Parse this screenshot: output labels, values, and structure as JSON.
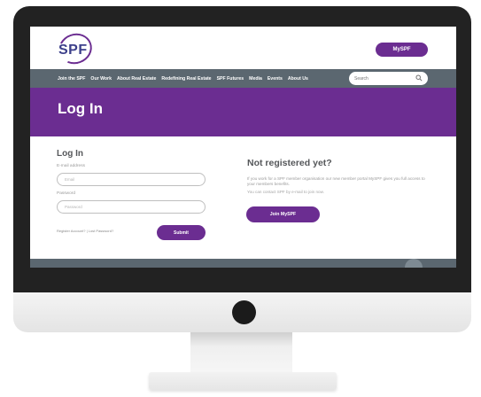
{
  "header": {
    "logo_text": "SPF",
    "myspf_label": "MySPF"
  },
  "nav": {
    "items": [
      "Join the SPF",
      "Our Work",
      "About Real Estate",
      "Redefining Real Estate",
      "SPF Futures",
      "Media",
      "Events",
      "About Us"
    ],
    "search_placeholder": "Search"
  },
  "hero": {
    "title": "Log In"
  },
  "login": {
    "heading": "Log In",
    "email_label": "E-mail address",
    "email_placeholder": "Email",
    "password_label": "Password",
    "password_placeholder": "Password",
    "links_text": "Register Account? | Lost Password?",
    "submit_label": "Submit"
  },
  "register": {
    "heading": "Not registered yet?",
    "text": "If you work for a SPF member organisation our new member portal MySPF gives you full access to your members benefits.",
    "note": "You can contact SPF by e-mail to join now.",
    "join_label": "Join MySPF"
  },
  "colors": {
    "brand": "#6b2d91",
    "nav": "#5b6770"
  }
}
